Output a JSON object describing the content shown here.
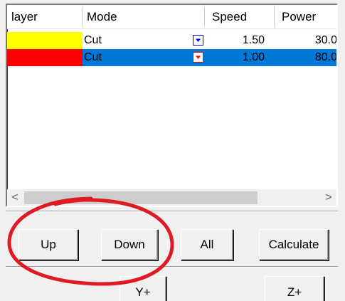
{
  "list": {
    "columns": {
      "layer": "layer",
      "mode": "Mode",
      "speed": "Speed",
      "power": "Power"
    },
    "rows": [
      {
        "color": "#ffff00",
        "mode": "Cut",
        "speed": "1.50",
        "power": "30.0",
        "selected": false,
        "dropdown_color": "#0000ff"
      },
      {
        "color": "#ff0000",
        "mode": "Cut",
        "speed": "1.00",
        "power": "80.0",
        "selected": true,
        "dropdown_color": "#ff0000"
      }
    ],
    "selection_color": "#0078d7",
    "scroll_left_glyph": "<",
    "scroll_right_glyph": ">"
  },
  "buttons": {
    "up": "Up",
    "down": "Down",
    "all": "All",
    "calculate": "Calculate",
    "y_plus": "Y+",
    "z_plus": "Z+"
  },
  "annotation": {
    "color": "#e01a22",
    "shape": "ellipse-around-up-down"
  }
}
